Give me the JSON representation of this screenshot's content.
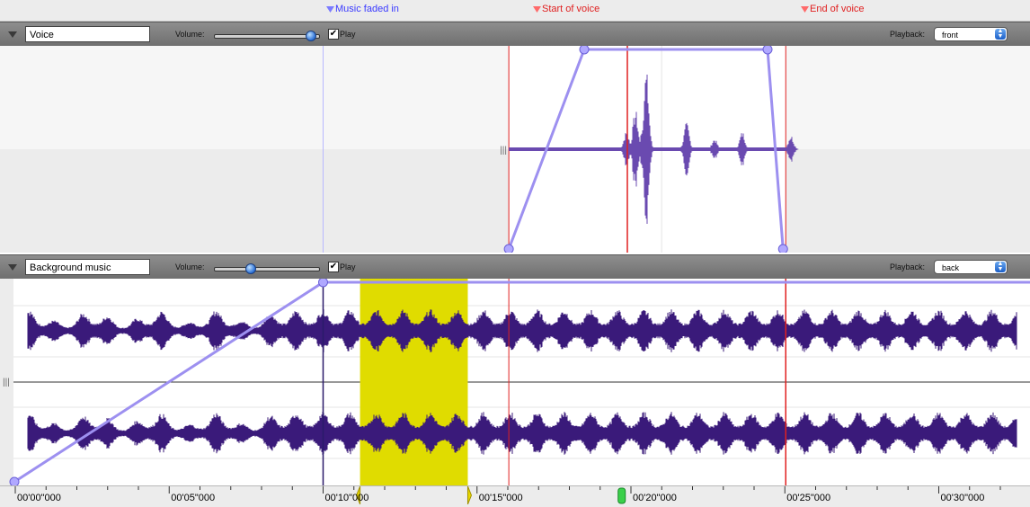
{
  "markers": [
    {
      "label": "Music faded in",
      "color": "#3a3aff",
      "t": 10.0
    },
    {
      "label": "Start of voice",
      "color": "#e02020",
      "t": 16.5
    },
    {
      "label": "End of voice",
      "color": "#e02020",
      "t": 25.0
    }
  ],
  "tracks": {
    "voice": {
      "name": "Voice",
      "volume_label": "Volume:",
      "volume_level": 0.93,
      "play_label": "Play",
      "play_checked": "✔",
      "playback_label": "Playback:",
      "playback_value": "front"
    },
    "music": {
      "name": "Background music",
      "volume_label": "Volume:",
      "volume_level": 0.35,
      "play_label": "Play",
      "play_checked": "✔",
      "playback_label": "Playback:",
      "playback_value": "back"
    }
  },
  "timeline": {
    "labels": [
      "00'00\"000",
      "00'05\"000",
      "00'10\"000",
      "00'15\"000",
      "00'20\"000",
      "00'25\"000",
      "00'30\"000"
    ],
    "label_times": [
      0,
      5,
      10,
      15,
      20,
      25,
      30
    ],
    "selection_seconds": [
      11.2,
      14.7
    ],
    "playhead_seconds": 19.7
  },
  "colors": {
    "waveform": "#3a1a7a",
    "voice_wave": "#6a4ab0",
    "envelope": "#9d90f0",
    "selection": "#e0dc00",
    "marker_red": "#e02020"
  }
}
